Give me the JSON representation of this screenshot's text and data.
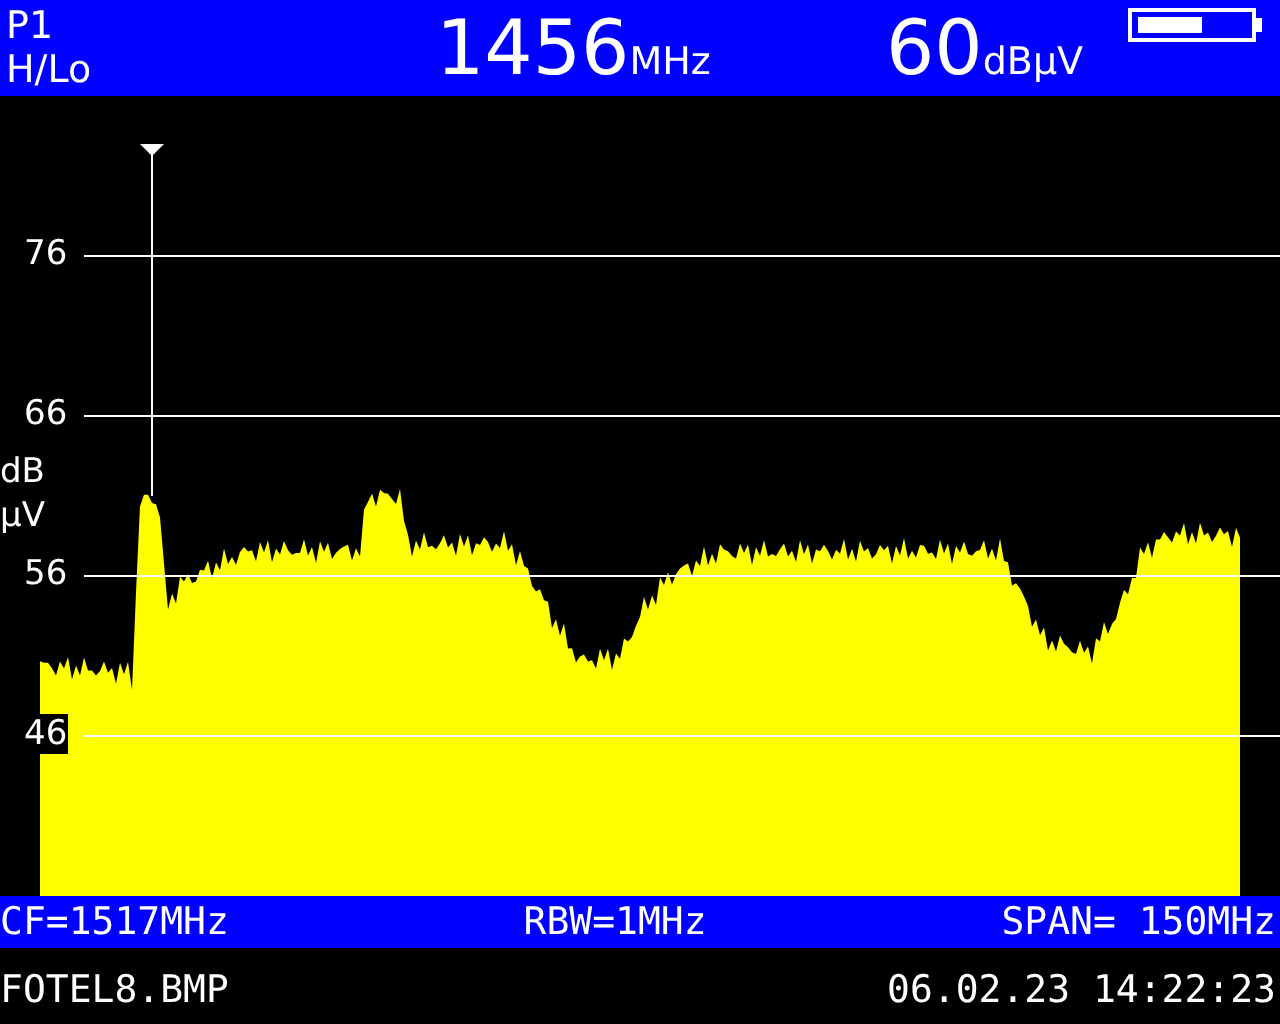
{
  "header": {
    "preset": "P1",
    "band": "H/Lo",
    "frequency": "1456",
    "frequency_unit": "MHz",
    "level": "60",
    "level_unit": "dBµV"
  },
  "spectrum": {
    "y_axis_unit": "dB µV",
    "y_ticks": [
      "76",
      "66",
      "56",
      "46"
    ],
    "marker": true
  },
  "settings_bar": {
    "center_frequency": "CF=1517MHz",
    "resolution_bandwidth": "RBW=1MHz",
    "span": "SPAN= 150MHz"
  },
  "footer": {
    "file_name": "FOTEL8.BMP",
    "date_time": "06.02.23 14:22:23"
  }
}
